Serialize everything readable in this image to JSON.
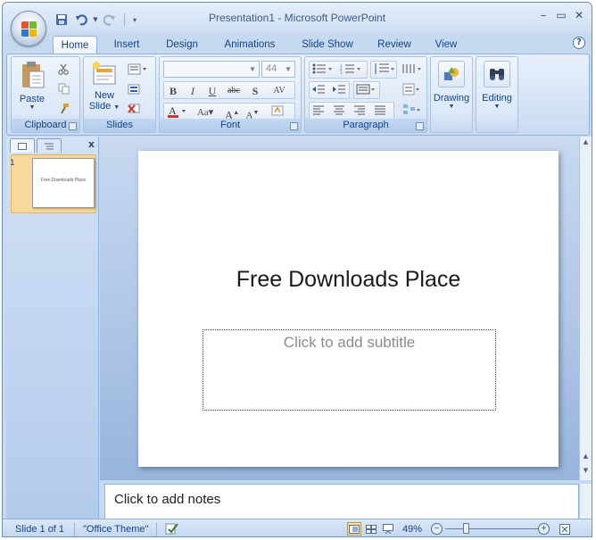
{
  "window": {
    "title": "Presentation1 - Microsoft PowerPoint"
  },
  "tabs": [
    "Home",
    "Insert",
    "Design",
    "Animations",
    "Slide Show",
    "Review",
    "View"
  ],
  "ribbon": {
    "clipboard": {
      "label": "Clipboard",
      "paste": "Paste"
    },
    "slides": {
      "label": "Slides",
      "new_slide_1": "New",
      "new_slide_2": "Slide"
    },
    "font": {
      "label": "Font",
      "font_name": "",
      "font_size": "44"
    },
    "paragraph": {
      "label": "Paragraph"
    },
    "drawing": {
      "label": "Drawing"
    },
    "editing": {
      "label": "Editing"
    }
  },
  "slide_panel": {
    "thumb_number": "1",
    "thumb_title": "Free Downloads Place"
  },
  "slide": {
    "title": "Free Downloads Place",
    "subtitle_placeholder": "Click to add subtitle"
  },
  "notes": {
    "placeholder": "Click to add notes"
  },
  "status": {
    "slide_counter": "Slide 1 of 1",
    "theme": "\"Office Theme\"",
    "zoom": "49%"
  },
  "zoom_level_fraction": 0.49,
  "colors": {
    "ribbon_text": "#15428b",
    "frame": "#c5d9f1"
  }
}
